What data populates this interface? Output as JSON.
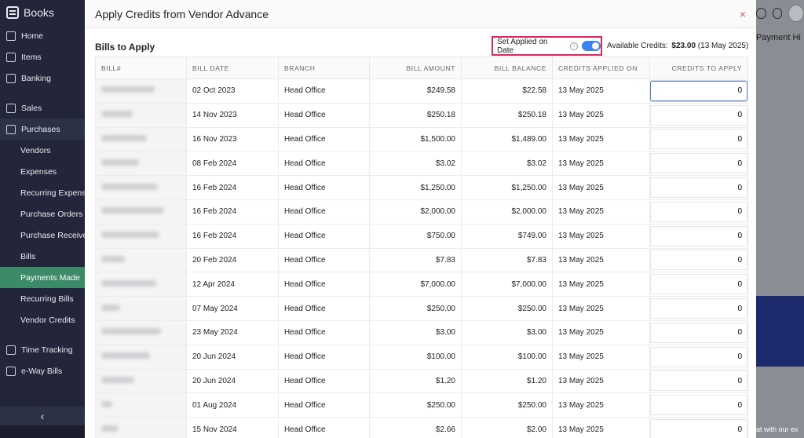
{
  "sidebar": {
    "brand": "Books",
    "items": [
      {
        "label": "Home",
        "kind": "top",
        "icon": "home-icon"
      },
      {
        "label": "Items",
        "kind": "top",
        "icon": "items-icon"
      },
      {
        "label": "Banking",
        "kind": "top",
        "icon": "bank-icon"
      },
      {
        "label": "Sales",
        "kind": "top",
        "icon": "cart-icon"
      },
      {
        "label": "Purchases",
        "kind": "section",
        "icon": "bag-icon"
      },
      {
        "label": "Vendors",
        "kind": "sub"
      },
      {
        "label": "Expenses",
        "kind": "sub"
      },
      {
        "label": "Recurring Expenses",
        "kind": "sub"
      },
      {
        "label": "Purchase Orders",
        "kind": "sub"
      },
      {
        "label": "Purchase Receives",
        "kind": "sub"
      },
      {
        "label": "Bills",
        "kind": "sub"
      },
      {
        "label": "Payments Made",
        "kind": "active"
      },
      {
        "label": "Recurring Bills",
        "kind": "sub"
      },
      {
        "label": "Vendor Credits",
        "kind": "sub"
      },
      {
        "label": "Time Tracking",
        "kind": "top",
        "icon": "clock-icon"
      },
      {
        "label": "e-Way Bills",
        "kind": "top",
        "icon": "truck-icon"
      }
    ],
    "collapse_glyph": "‹"
  },
  "bgapp": {
    "payment_history": "Payment Hi",
    "chat": "at with our ex"
  },
  "modal": {
    "title": "Apply Credits from Vendor Advance",
    "close_glyph": "×",
    "section_title": "Bills to Apply",
    "toggle_label": "Set Applied on Date",
    "toggle_on": true,
    "available_label": "Available Credits:",
    "available_amount": "$23.00",
    "available_date": "(13 May 2025)",
    "columns": [
      "BILL#",
      "BILL DATE",
      "BRANCH",
      "BILL AMOUNT",
      "BILL BALANCE",
      "CREDITS APPLIED ON",
      "CREDITS TO APPLY"
    ],
    "rows": [
      {
        "date": "02 Oct 2023",
        "branch": "Head Office",
        "amount": "$249.58",
        "balance": "$22.58",
        "applied_on": "13 May 2025",
        "credit": "0"
      },
      {
        "date": "14 Nov 2023",
        "branch": "Head Office",
        "amount": "$250.18",
        "balance": "$250.18",
        "applied_on": "13 May 2025",
        "credit": "0"
      },
      {
        "date": "16 Nov 2023",
        "branch": "Head Office",
        "amount": "$1,500.00",
        "balance": "$1,489.00",
        "applied_on": "13 May 2025",
        "credit": "0"
      },
      {
        "date": "08 Feb 2024",
        "branch": "Head Office",
        "amount": "$3.02",
        "balance": "$3.02",
        "applied_on": "13 May 2025",
        "credit": "0"
      },
      {
        "date": "16 Feb 2024",
        "branch": "Head Office",
        "amount": "$1,250.00",
        "balance": "$1,250.00",
        "applied_on": "13 May 2025",
        "credit": "0"
      },
      {
        "date": "16 Feb 2024",
        "branch": "Head Office",
        "amount": "$2,000.00",
        "balance": "$2,000.00",
        "applied_on": "13 May 2025",
        "credit": "0"
      },
      {
        "date": "16 Feb 2024",
        "branch": "Head Office",
        "amount": "$750.00",
        "balance": "$749.00",
        "applied_on": "13 May 2025",
        "credit": "0"
      },
      {
        "date": "20 Feb 2024",
        "branch": "Head Office",
        "amount": "$7.83",
        "balance": "$7.83",
        "applied_on": "13 May 2025",
        "credit": "0"
      },
      {
        "date": "12 Apr 2024",
        "branch": "Head Office",
        "amount": "$7,000.00",
        "balance": "$7,000.00",
        "applied_on": "13 May 2025",
        "credit": "0"
      },
      {
        "date": "07 May 2024",
        "branch": "Head Office",
        "amount": "$250.00",
        "balance": "$250.00",
        "applied_on": "13 May 2025",
        "credit": "0"
      },
      {
        "date": "23 May 2024",
        "branch": "Head Office",
        "amount": "$3.00",
        "balance": "$3.00",
        "applied_on": "13 May 2025",
        "credit": "0"
      },
      {
        "date": "20 Jun 2024",
        "branch": "Head Office",
        "amount": "$100.00",
        "balance": "$100.00",
        "applied_on": "13 May 2025",
        "credit": "0"
      },
      {
        "date": "20 Jun 2024",
        "branch": "Head Office",
        "amount": "$1.20",
        "balance": "$1.20",
        "applied_on": "13 May 2025",
        "credit": "0"
      },
      {
        "date": "01 Aug 2024",
        "branch": "Head Office",
        "amount": "$250.00",
        "balance": "$250.00",
        "applied_on": "13 May 2025",
        "credit": "0"
      },
      {
        "date": "15 Nov 2024",
        "branch": "Head Office",
        "amount": "$2.66",
        "balance": "$2.00",
        "applied_on": "13 May 2025",
        "credit": "0"
      }
    ]
  },
  "colors": {
    "sidebar_bg": "#23263a",
    "active_nav": "#3b8a68",
    "highlight_box": "#e0245e",
    "toggle_on": "#3b82f6",
    "close": "#d9534f"
  }
}
